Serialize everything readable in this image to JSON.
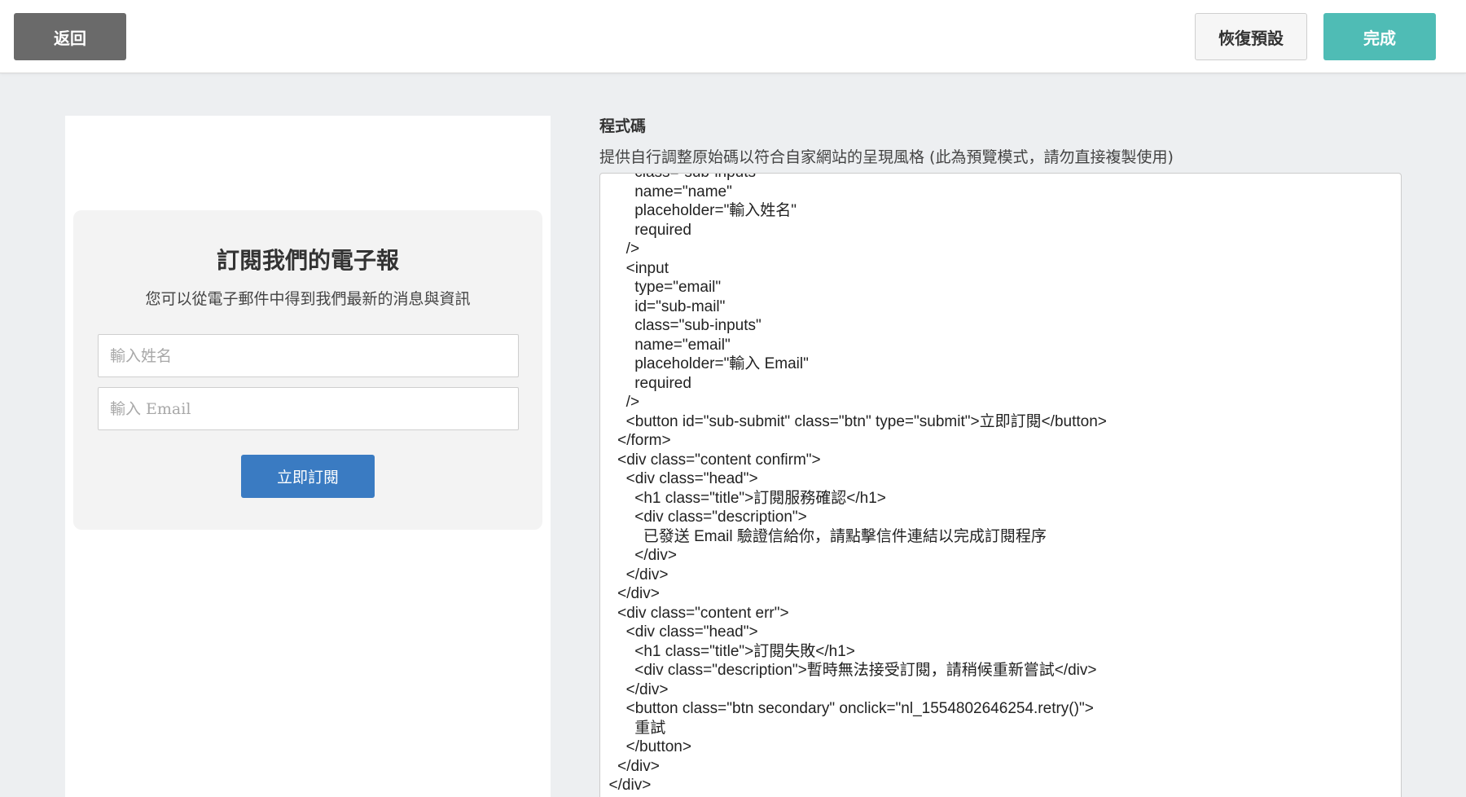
{
  "toolbar": {
    "back_label": "返回",
    "reset_label": "恢復預設",
    "done_label": "完成"
  },
  "preview": {
    "title": "訂閱我們的電子報",
    "description": "您可以從電子郵件中得到我們最新的消息與資訊",
    "name_placeholder": "輸入姓名",
    "email_placeholder": "輸入 Email",
    "submit_label": "立即訂閱"
  },
  "code": {
    "label": "程式碼",
    "hint": "提供自行調整原始碼以符合自家網站的呈現風格 (此為預覽模式，請勿直接複製使用)",
    "lines": [
      "        class=\"sub-inputs\"",
      "        name=\"name\"",
      "        placeholder=\"輸入姓名\"",
      "        required",
      "      />",
      "      <input",
      "        type=\"email\"",
      "        id=\"sub-mail\"",
      "        class=\"sub-inputs\"",
      "        name=\"email\"",
      "        placeholder=\"輸入 Email\"",
      "        required",
      "      />",
      "      <button id=\"sub-submit\" class=\"btn\" type=\"submit\">立即訂閱</button>",
      "    </form>",
      "    <div class=\"content confirm\">",
      "      <div class=\"head\">",
      "        <h1 class=\"title\">訂閱服務確認</h1>",
      "        <div class=\"description\">",
      "          已發送 Email 驗證信給你，請點擊信件連結以完成訂閱程序",
      "        </div>",
      "      </div>",
      "    </div>",
      "    <div class=\"content err\">",
      "      <div class=\"head\">",
      "        <h1 class=\"title\">訂閱失敗</h1>",
      "        <div class=\"description\">暫時無法接受訂閱，請稍候重新嘗試</div>",
      "      </div>",
      "      <button class=\"btn secondary\" onclick=\"nl_1554802646254.retry()\">",
      "        重試",
      "      </button>",
      "    </div>",
      "  </div>"
    ]
  }
}
